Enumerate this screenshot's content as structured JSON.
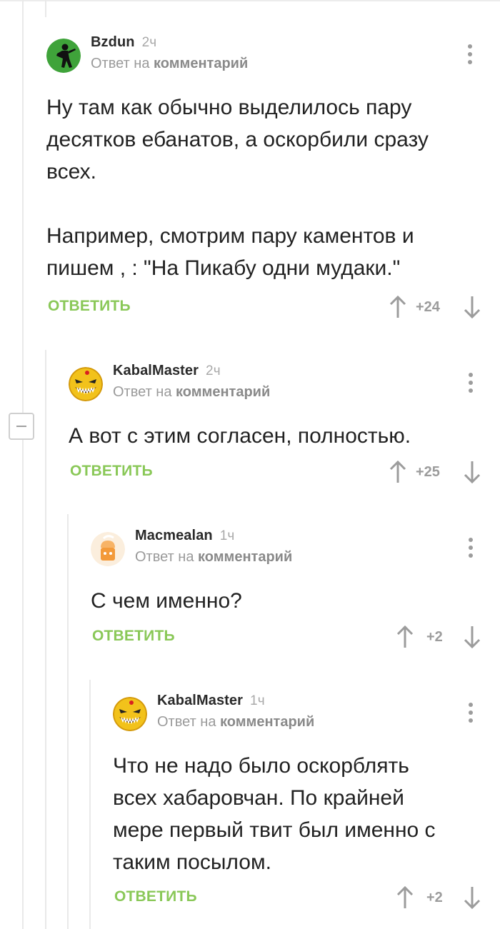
{
  "comments": [
    {
      "author": "Bzdun",
      "time": "2ч",
      "reply_prefix": "Ответ на",
      "reply_target": "комментарий",
      "paragraphs": [
        "Ну там как обычно выделилось пару десятков ебанатов, а оскорбили сразу всех.",
        "Например, смотрим пару каментов и пишем , : \"На Пикабу одни мудаки.\""
      ],
      "reply_label": "ОТВЕТИТЬ",
      "score": "+24"
    },
    {
      "author": "KabalMaster",
      "time": "2ч",
      "reply_prefix": "Ответ на",
      "reply_target": "комментарий",
      "paragraphs": [
        "А вот с этим согласен, полностью."
      ],
      "reply_label": "ОТВЕТИТЬ",
      "score": "+25"
    },
    {
      "author": "Macmealan",
      "time": "1ч",
      "reply_prefix": "Ответ на",
      "reply_target": "комментарий",
      "paragraphs": [
        "С чем именно?"
      ],
      "reply_label": "ОТВЕТИТЬ",
      "score": "+2"
    },
    {
      "author": "KabalMaster",
      "time": "1ч",
      "reply_prefix": "Ответ на",
      "reply_target": "комментарий",
      "paragraphs": [
        "Что не надо было оскорблять всех хабаровчан. По крайней мере первый твит был именно с таким посылом."
      ],
      "reply_label": "ОТВЕТИТЬ",
      "score": "+2"
    }
  ],
  "icons": {
    "menu": "more-vertical-icon",
    "upvote": "arrow-up-icon",
    "downvote": "arrow-down-icon",
    "collapse": "collapse-minus-icon"
  },
  "colors": {
    "accent_green": "#8ac858",
    "muted": "#9c9c9c",
    "thread_line": "#e9e9e9"
  }
}
